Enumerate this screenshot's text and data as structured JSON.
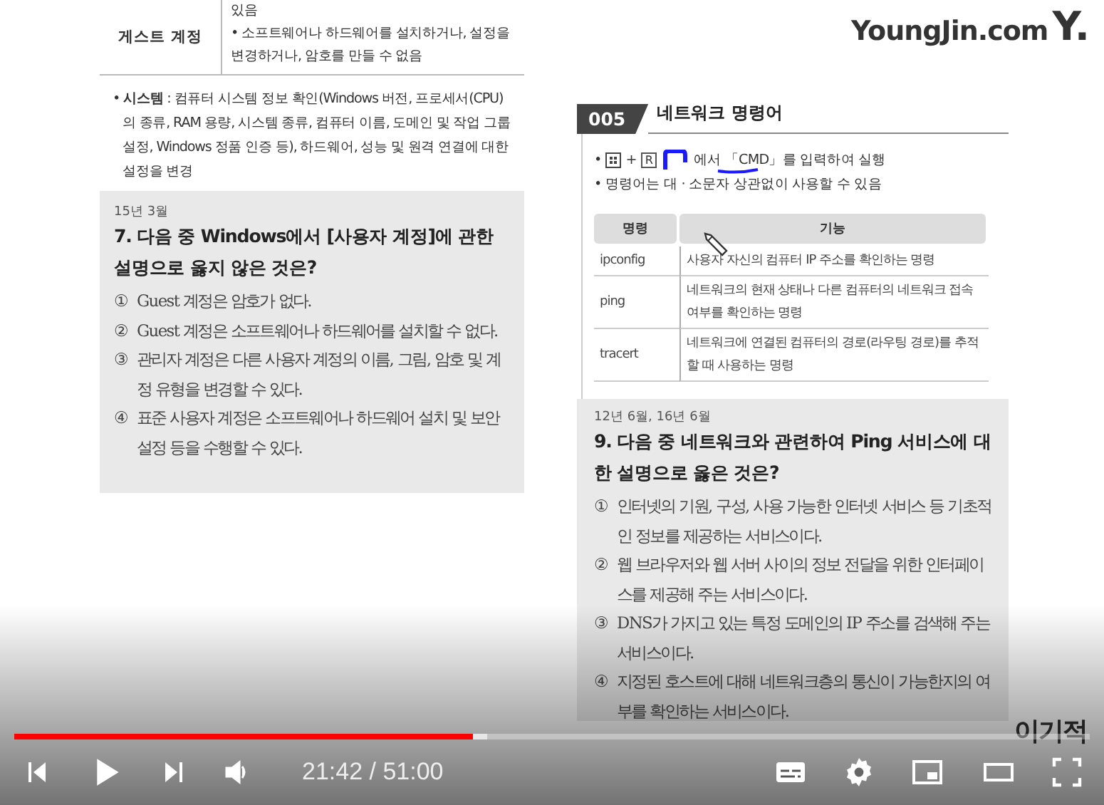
{
  "logo": {
    "text": "YoungJin.com",
    "mark": "Y."
  },
  "left_page": {
    "account_table": {
      "label": "게스트 계정",
      "lines": [
        "있음",
        "• 소프트웨어나 하드웨어를 설치하거나, 설정을 변경하거나, 암호를 만들 수 없음"
      ]
    },
    "system_note": "• **시스템** : 컴퓨터 시스템 정보 확인(Windows 버전, 프로세서(CPU)의 종류, RAM 용량, 시스템 종류, 컴퓨터 이름, 도메인 및 작업 그룹 설정, Windows 정품 인증 등), 하드웨어, 성능 및 원격 연결에 대한 설정을 변경",
    "question": {
      "date": "15년 3월",
      "title": "7. 다음 중 Windows에서 [사용자 계정]에 관한 설명으로 옳지 않은 것은?",
      "options": [
        {
          "mark": "①",
          "text": "Guest 계정은 암호가 없다."
        },
        {
          "mark": "②",
          "text": "Guest 계정은 소프트웨어나 하드웨어를 설치할 수 없다."
        },
        {
          "mark": "③",
          "text": "관리자 계정은 다른 사용자 계정의 이름, 그림, 암호 및 계정 유형을 변경할 수 있다."
        },
        {
          "mark": "④",
          "text": "표준 사용자 계정은 소프트웨어나 하드웨어 설치 및 보안 설정 등을 수행할 수 있다."
        }
      ]
    }
  },
  "right_page": {
    "section": {
      "number": "005",
      "title": "네트워크 명령어"
    },
    "run_note": {
      "bullet": "•",
      "key": "R",
      "plus": "+",
      "text": "에서 「CMD」를 입력하여 실행"
    },
    "notes": [
      "• 명령어는 대 · 소문자 상관없이 사용할 수 있음"
    ],
    "table": {
      "columns": [
        "명령",
        "기능"
      ],
      "rows": [
        {
          "command": "ipconfig",
          "function": "사용자 자신의 컴퓨터 IP 주소를 확인하는 명령"
        },
        {
          "command": "ping",
          "function": "네트워크의 현재 상태나 다른 컴퓨터의 네트워크 접속 여부를 확인하는 명령"
        },
        {
          "command": "tracert",
          "function": "네트워크에 연결된 컴퓨터의 경로(라우팅 경로)를 추적할 때 사용하는 명령"
        }
      ]
    },
    "question": {
      "date": "12년 6월, 16년 6월",
      "title": "9. 다음 중 네트워크와 관련하여 Ping 서비스에 대한 설명으로 옳은 것은?",
      "options": [
        {
          "mark": "①",
          "text": "인터넷의 기원, 구성, 사용 가능한 인터넷 서비스 등 기초적인 정보를 제공하는 서비스이다."
        },
        {
          "mark": "②",
          "text": "웹 브라우저와 웹 서버 사이의 정보 전달을 위한 인터페이스를 제공해 주는 서비스이다."
        },
        {
          "mark": "③",
          "text": "DNS가 가지고 있는 특정 도메인의 IP 주소를 검색해 주는 서비스이다."
        },
        {
          "mark": "④",
          "text": "지정된 호스트에 대해 네트워크층의 통신이 가능한지의 여부를 확인하는 서비스이다."
        }
      ]
    }
  },
  "channel_badge": {
    "text": "이기적"
  },
  "player": {
    "progress": {
      "level": 0.426
    },
    "buffer": {
      "level": 0.44
    },
    "time": "21:42 / 51:00"
  }
}
